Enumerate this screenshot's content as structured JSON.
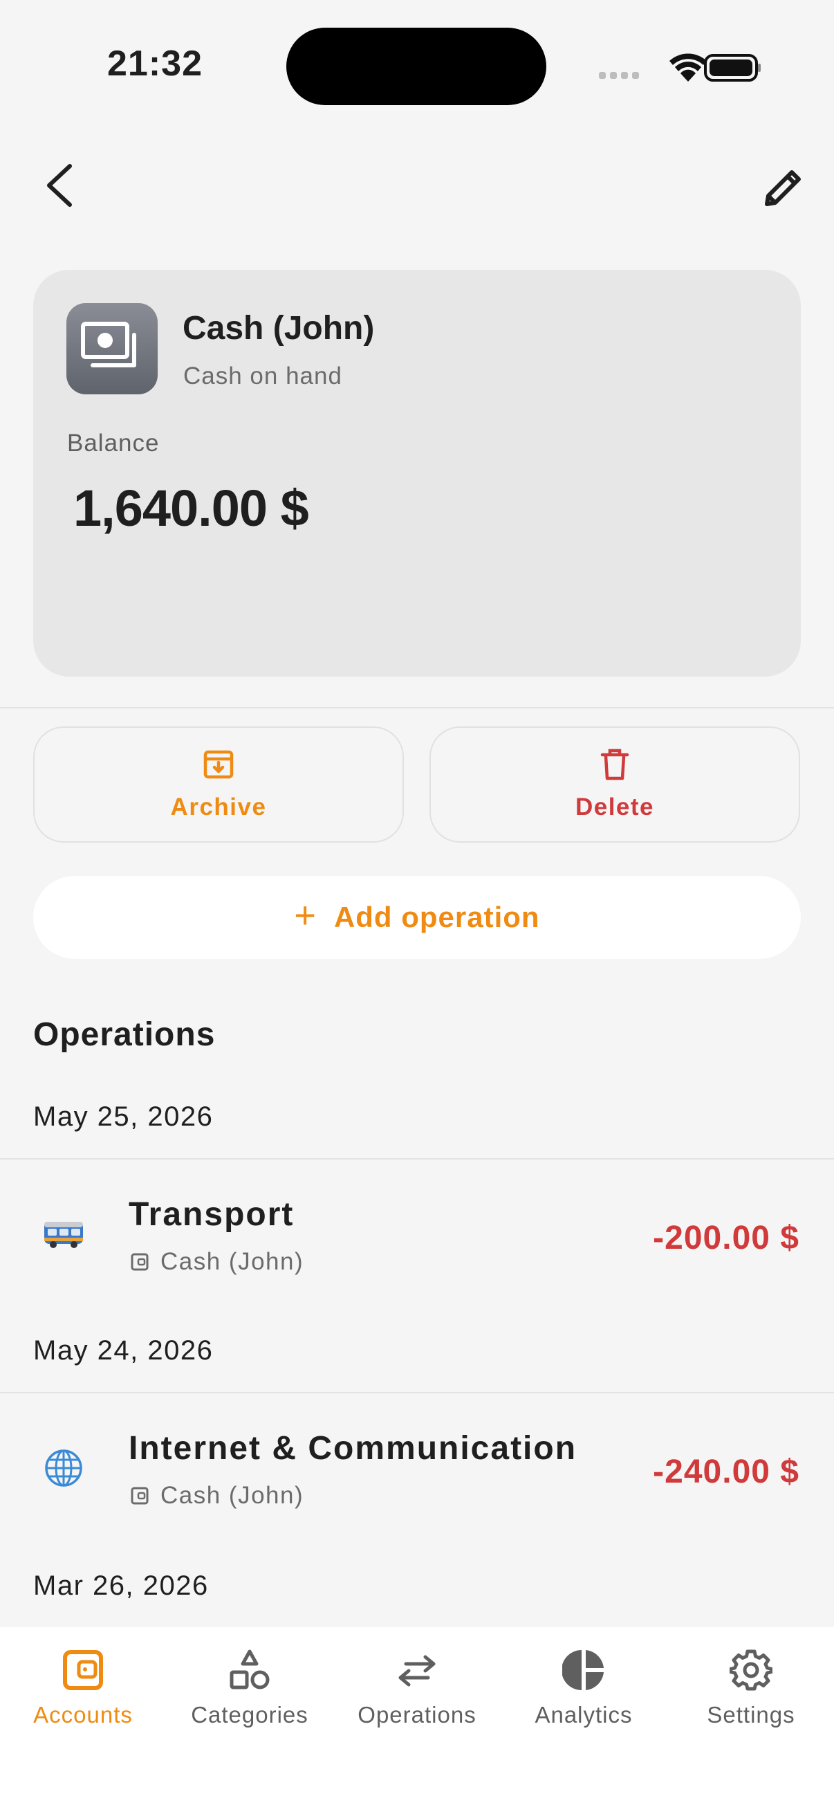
{
  "status_bar": {
    "time": "21:32"
  },
  "account": {
    "name": "Cash (John)",
    "type": "Cash on hand",
    "balance_label": "Balance",
    "balance": "1,640.00 $",
    "icon": "cash-icon"
  },
  "actions": {
    "archive_label": "Archive",
    "delete_label": "Delete",
    "add_operation_label": "Add operation"
  },
  "operations": {
    "heading": "Operations",
    "groups": [
      {
        "date": "May 25, 2026",
        "items": [
          {
            "title": "Transport",
            "account": "Cash (John)",
            "amount": "-200.00 $",
            "icon": "bus-icon"
          }
        ]
      },
      {
        "date": "May 24, 2026",
        "items": [
          {
            "title": "Internet & Communication",
            "account": "Cash (John)",
            "amount": "-240.00 $",
            "icon": "globe-icon"
          }
        ]
      },
      {
        "date": "Mar 26, 2026",
        "items": []
      }
    ]
  },
  "tabbar": {
    "tabs": [
      {
        "label": "Accounts",
        "icon": "wallet-icon",
        "active": true
      },
      {
        "label": "Categories",
        "icon": "shapes-icon",
        "active": false
      },
      {
        "label": "Operations",
        "icon": "arrows-icon",
        "active": false
      },
      {
        "label": "Analytics",
        "icon": "pie-chart-icon",
        "active": false
      },
      {
        "label": "Settings",
        "icon": "gear-icon",
        "active": false
      }
    ]
  },
  "colors": {
    "accent": "#ef8b12",
    "danger": "#d03a3a",
    "background": "#f5f5f5",
    "card": "#e7e7e7"
  }
}
